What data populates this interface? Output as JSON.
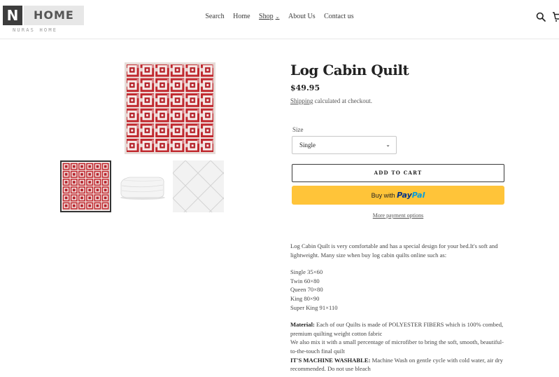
{
  "brand": {
    "mark": "N",
    "name": "HOME",
    "tagline": "NURAS HOME"
  },
  "nav": {
    "items": [
      {
        "label": "Search",
        "active": false
      },
      {
        "label": "Home",
        "active": false
      },
      {
        "label": "Shop",
        "active": true,
        "has_dropdown": true
      },
      {
        "label": "About Us",
        "active": false
      },
      {
        "label": "Contact us",
        "active": false
      }
    ]
  },
  "header_icons": [
    "search-icon",
    "cart-icon"
  ],
  "gallery": {
    "main_image": "red log cabin quilt",
    "thumbnails": [
      "red log cabin quilt",
      "folded white quilt",
      "white quilted fabric"
    ],
    "selected_index": 0
  },
  "product": {
    "title": "Log Cabin Quilt",
    "price": "$49.95",
    "shipping_link": "Shipping",
    "shipping_text": " calculated at checkout.",
    "size_label": "Size",
    "size_value": "Single",
    "add_to_cart": "ADD TO CART",
    "paypal_prefix": "Buy with",
    "paypal_pay": "Pay",
    "paypal_pal": "Pal",
    "more_payment": "More payment options"
  },
  "description": {
    "intro": "Log Cabin Quilt is very comfortable and has a special design for your bed.It's soft and lightweight. Many size when buy log cabin quilts online such as:",
    "sizes": [
      "Single 35×60",
      "Twin 60×80",
      "Queen 70×80",
      "King 80×90",
      "Super King 91×110"
    ],
    "material_label": "Material:",
    "material_text": " Each of our Quilts is made of POLYESTER FIBERS which is 100% combed, premium quilting weight cotton fabric",
    "microfiber_text": "We also mix it with a small percentage of microfiber to bring the soft, smooth, beautiful-to-the-touch final quilt",
    "washable_label": "IT'S MACHINE WASHABLE:",
    "washable_text": " Machine Wash on gentle cycle with cold water, air dry recommended. Do not use bleach"
  },
  "colors": {
    "quilt_red": "#c0272d",
    "paypal_yellow": "#ffc439",
    "paypal_blue_dark": "#003087",
    "paypal_blue_light": "#009cde"
  }
}
